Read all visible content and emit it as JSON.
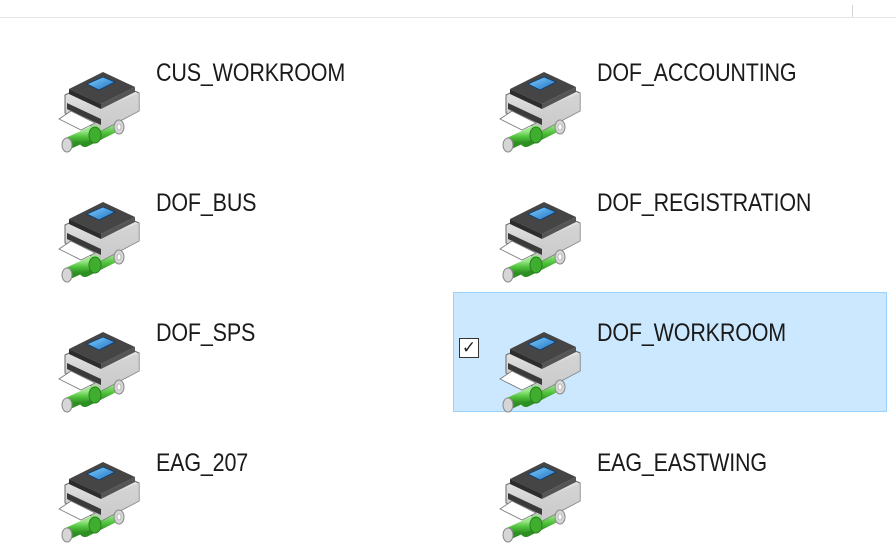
{
  "printers": [
    {
      "name": "CUS_WORKROOM",
      "selected": false,
      "icon": "network-printer-icon"
    },
    {
      "name": "DOF_ACCOUNTING",
      "selected": false,
      "icon": "network-printer-icon"
    },
    {
      "name": "DOF_BUS",
      "selected": false,
      "icon": "network-printer-icon"
    },
    {
      "name": "DOF_REGISTRATION",
      "selected": false,
      "icon": "network-printer-icon"
    },
    {
      "name": "DOF_SPS",
      "selected": false,
      "icon": "network-printer-icon"
    },
    {
      "name": "DOF_WORKROOM",
      "selected": true,
      "checkbox": "✓",
      "icon": "network-printer-icon"
    },
    {
      "name": "EAG_207",
      "selected": false,
      "icon": "network-printer-icon"
    },
    {
      "name": "EAG_EASTWING",
      "selected": false,
      "icon": "network-printer-icon"
    }
  ],
  "colors": {
    "selection_fill": "#cce8ff",
    "selection_border": "#99d1ff",
    "pipe_green": "#5ecb4a",
    "printer_dark": "#3b3b3b"
  }
}
